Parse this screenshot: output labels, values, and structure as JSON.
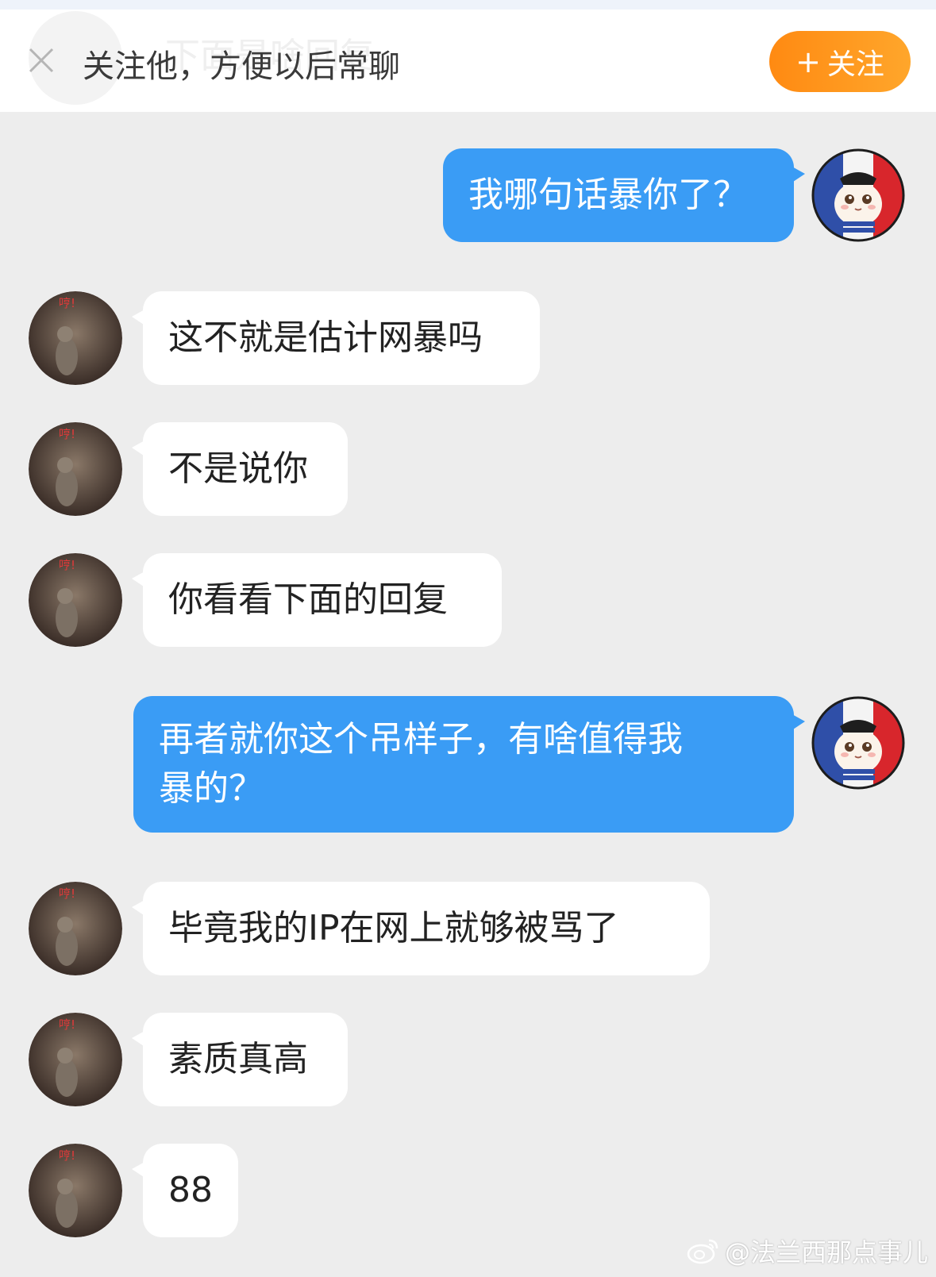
{
  "follow_bar": {
    "ghost_text": "下面是啥回复",
    "hint": "关注他，方便以后常聊",
    "follow_label": "关注",
    "follow_plus": "+"
  },
  "avatar_sticker_text": "哼!",
  "messages": [
    {
      "side": "out",
      "text": "我哪句话暴你了？"
    },
    {
      "side": "in",
      "text": "这不就是估计网暴吗"
    },
    {
      "side": "in",
      "text": "不是说你"
    },
    {
      "side": "in",
      "text": "你看看下面的回复"
    },
    {
      "side": "out",
      "lines": [
        "再者就你这个吊样子，有啥值得我",
        "暴的？"
      ]
    },
    {
      "side": "in",
      "text": "毕竟我的IP在网上就够被骂了"
    },
    {
      "side": "in",
      "text": "素质真高"
    },
    {
      "side": "in",
      "text": "88"
    }
  ],
  "watermark": "@法兰西那点事儿",
  "colors": {
    "background": "#ededed",
    "outgoing_bubble": "#3a9cf5",
    "incoming_bubble": "#ffffff",
    "follow_button": "#ff9a1f"
  }
}
